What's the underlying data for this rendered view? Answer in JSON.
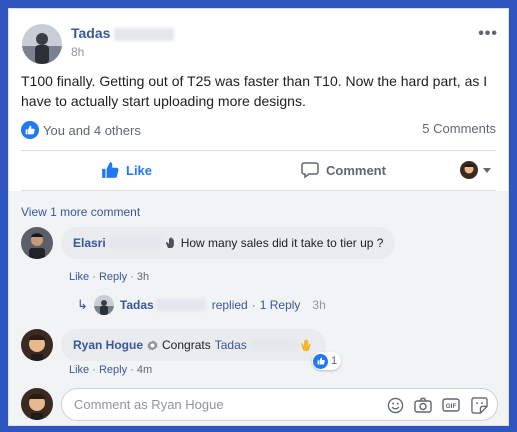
{
  "post": {
    "author": "Tadas",
    "time": "8h",
    "menu_label": "•••",
    "text": "T100 finally. Getting out of T25 was faster than T10. Now the hard part, as I have to actually start uploading more designs.",
    "reactions_text": "You and 4 others",
    "comments_count": "5 Comments"
  },
  "actions": {
    "like": "Like",
    "comment": "Comment"
  },
  "comments": {
    "view_more": "View 1 more comment",
    "items": [
      {
        "author": "Elasri",
        "text": "How many sales did it take to tier up ?",
        "like": "Like",
        "reply": "Reply",
        "time": "3h",
        "reply_summary": {
          "author": "Tadas",
          "replied": "replied",
          "count": "1 Reply",
          "time": "3h"
        }
      },
      {
        "author": "Ryan Hogue",
        "text": "Congrats",
        "mention": "Tadas",
        "like": "Like",
        "reply": "Reply",
        "time": "4m",
        "reaction_count": "1"
      }
    ]
  },
  "composer": {
    "placeholder": "Comment as Ryan Hogue"
  },
  "colors": {
    "link": "#385898",
    "accent": "#2078f4",
    "frame": "#2f56c0"
  }
}
